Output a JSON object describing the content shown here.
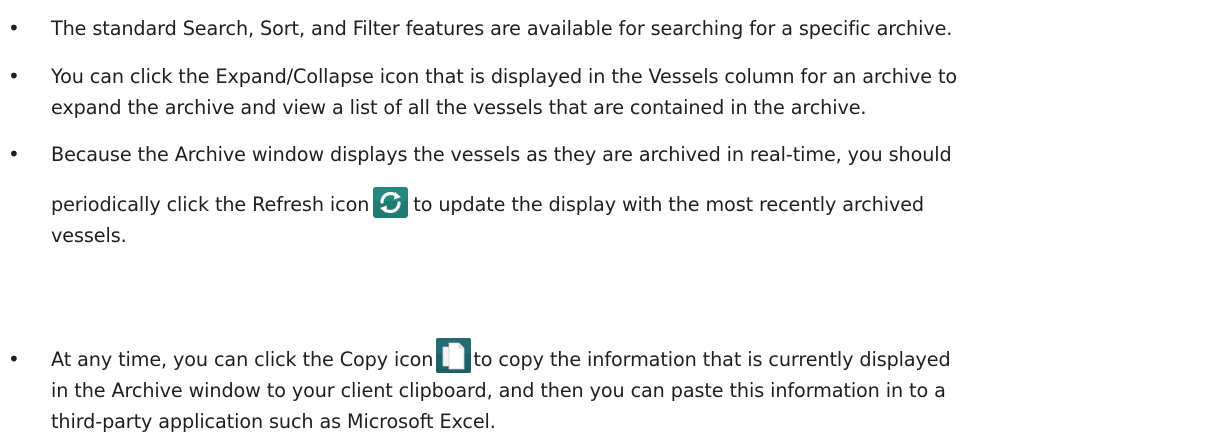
{
  "bullets": {
    "symbol": "•",
    "item1": {
      "line1": "The standard Search, Sort, and Filter features are available for searching for a specific archive."
    },
    "item2": {
      "line1": "You can click the Expand/Collapse icon that is displayed in the Vessels column for an archive to",
      "line2": "expand the archive and view a list of all the vessels that are contained in the archive."
    },
    "item3": {
      "line1": "Because the Archive window displays the vessels as they are archived in real-time, you should",
      "line2_before_icon": "periodically click the Refresh icon",
      "line2_after_icon": "to update the display with the most recently archived",
      "line3": "vessels.",
      "icon": "refresh-icon"
    },
    "item4": {
      "line1_before_icon": "At any time, you can click the Copy icon",
      "line1_after_icon": "to copy the information that is currently displayed",
      "line2": "in the Archive window to your client clipboard, and then you can paste this information in to a",
      "line3": "third-party application such as Microsoft Excel.",
      "icon": "copy-icon"
    }
  },
  "colors": {
    "text": "#1f1f1f",
    "refresh_icon_bg": "#1f7a72",
    "copy_icon_bg": "#1e5f68"
  }
}
